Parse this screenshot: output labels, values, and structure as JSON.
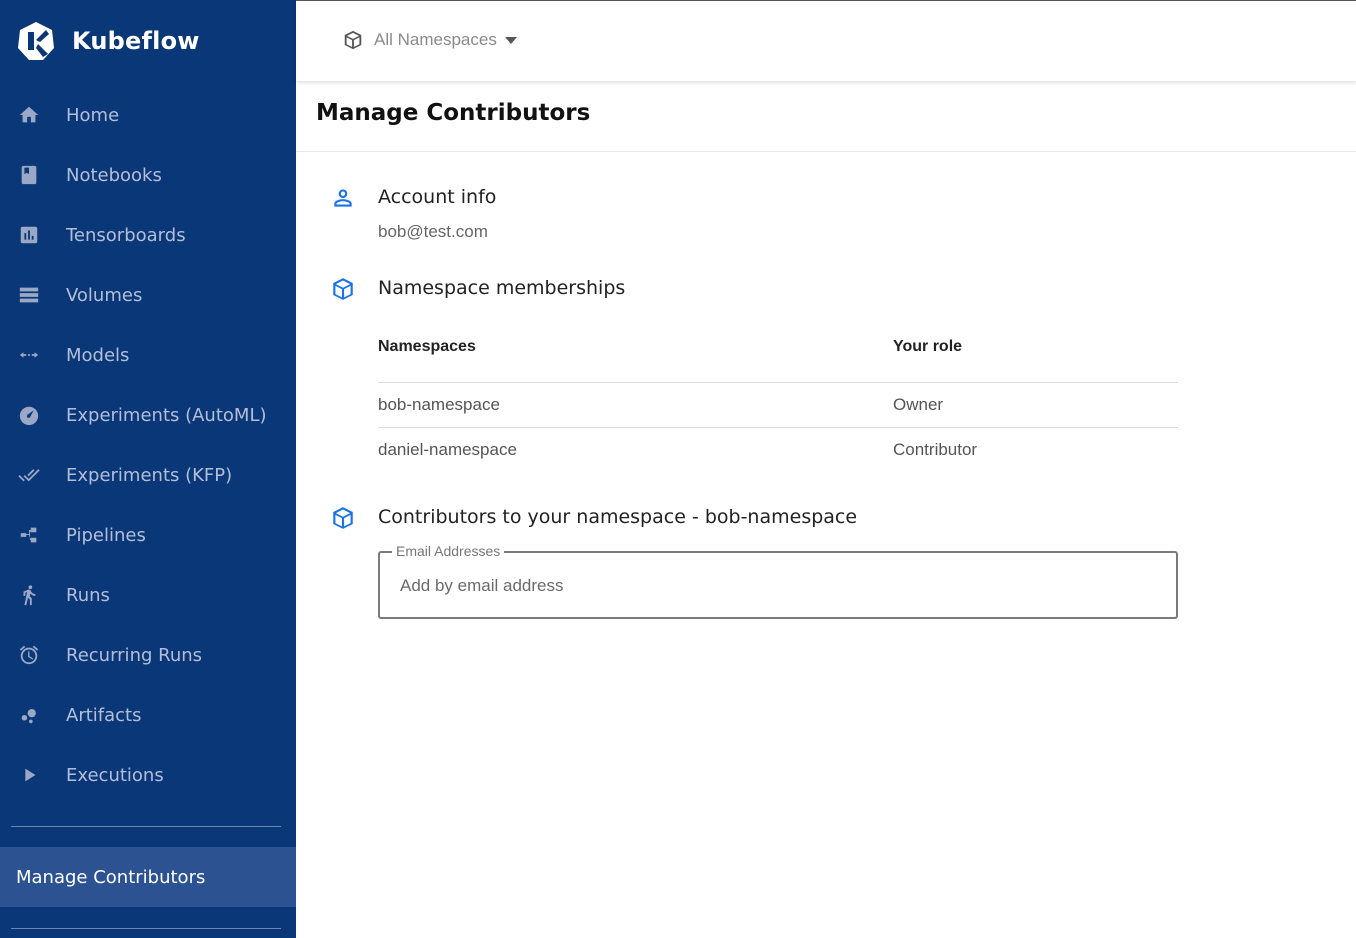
{
  "sidebar": {
    "brand": "Kubeflow",
    "items": [
      {
        "label": "Home",
        "icon": "home-icon"
      },
      {
        "label": "Notebooks",
        "icon": "notebook-icon"
      },
      {
        "label": "Tensorboards",
        "icon": "chart-icon"
      },
      {
        "label": "Volumes",
        "icon": "storage-icon"
      },
      {
        "label": "Models",
        "icon": "arrows-icon"
      },
      {
        "label": "Experiments (AutoML)",
        "icon": "speedometer-icon"
      },
      {
        "label": "Experiments (KFP)",
        "icon": "double-check-icon"
      },
      {
        "label": "Pipelines",
        "icon": "pipeline-icon"
      },
      {
        "label": "Runs",
        "icon": "run-icon"
      },
      {
        "label": "Recurring Runs",
        "icon": "alarm-icon"
      },
      {
        "label": "Artifacts",
        "icon": "bubbles-icon"
      },
      {
        "label": "Executions",
        "icon": "play-icon"
      }
    ],
    "active": "Manage Contributors",
    "colors": {
      "background": "#0a3778",
      "active_background": "#2c5291"
    }
  },
  "topbar": {
    "namespace_selector": "All Namespaces"
  },
  "page": {
    "title": "Manage Contributors",
    "account": {
      "title": "Account info",
      "email": "bob@test.com"
    },
    "memberships": {
      "title": "Namespace memberships",
      "columns": [
        "Namespaces",
        "Your role"
      ],
      "rows": [
        {
          "namespace": "bob-namespace",
          "role": "Owner"
        },
        {
          "namespace": "daniel-namespace",
          "role": "Contributor"
        }
      ]
    },
    "contributors": {
      "title": "Contributors to your namespace - bob-namespace",
      "field_label": "Email Addresses",
      "placeholder": "Add by email address",
      "value": ""
    },
    "accent_color": "#1a73e8"
  }
}
